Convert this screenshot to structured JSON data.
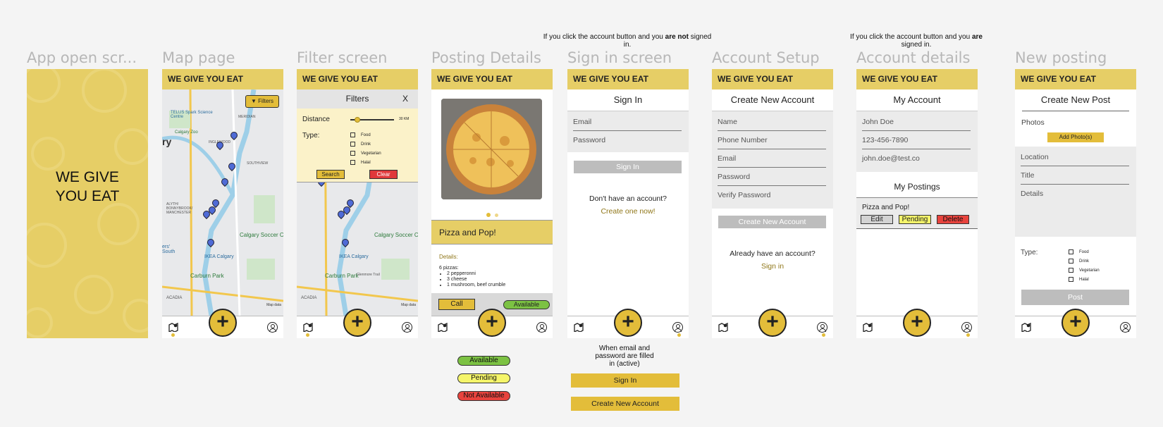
{
  "brand": "WE GIVE YOU EAT",
  "titles": [
    "App open scr...",
    "Map page",
    "Filter screen",
    "Posting Details",
    "Sign in screen",
    "Account Setup",
    "Account details",
    "New posting"
  ],
  "notes": {
    "not_signed_pre": "If you click the account button and you ",
    "not_signed_bold": "are not",
    "not_signed_post": " signed in.",
    "signed_pre": "If you click the account button and you ",
    "signed_bold": "are",
    "signed_post": " signed in.",
    "active_state": "When email and password are filled in (active)"
  },
  "splash": {
    "line1": "WE GIVE",
    "line2": "YOU EAT"
  },
  "map": {
    "filters_button": "Filters",
    "labels": [
      "TELUS Spark Science Centre",
      "MERIDIAN",
      "ry",
      "Calgary Zoo",
      "INGLEWOOD",
      "SOUTHVIEW",
      "FOREST HEIGHTS",
      "ALYTH/ BONNYBROOK/ MANCHESTER",
      "Calgary Soccer Cent",
      "IKEA Calgary",
      "ers' South",
      "Carburn Park",
      "Glenmore Trail",
      "ACADIA",
      "Map data",
      "Memorial Dr"
    ]
  },
  "filter": {
    "title": "Filters",
    "close": "X",
    "distance_label": "Distance",
    "distance_value": "30 KM",
    "type_label": "Type:",
    "types": [
      "Food",
      "Drink",
      "Vegetarian",
      "Halal"
    ],
    "search": "Search",
    "clear": "Clear"
  },
  "posting": {
    "title": "Pizza and Pop!",
    "details_label": "Details:",
    "summary": "6 pizzas:",
    "items": [
      "2 pepperonni",
      "3 cheese",
      "1 mushroom, beef crumble"
    ],
    "call": "Call",
    "status": "Available"
  },
  "status_legend": {
    "available": "Available",
    "pending": "Pending",
    "not_available": "Not Available"
  },
  "signin": {
    "title": "Sign In",
    "email": "Email",
    "password": "Password",
    "button": "Sign In",
    "no_account": "Don't have an account?",
    "create_link": "Create one now!",
    "active_signin": "Sign In",
    "active_create": "Create New Account"
  },
  "setup": {
    "title": "Create New Account",
    "fields": [
      "Name",
      "Phone Number",
      "Email",
      "Password",
      "Verify Password"
    ],
    "button": "Create New Account",
    "have_account": "Already have an account?",
    "signin_link": "Sign in"
  },
  "account": {
    "title": "My Account",
    "name": "John Doe",
    "phone": "123-456-7890",
    "email": "john.doe@test.co",
    "postings_title": "My Postings",
    "posting_name": "Pizza and Pop!",
    "edit": "Edit",
    "pending": "Pending",
    "delete": "Delete"
  },
  "newpost": {
    "title": "Create New Post",
    "photos": "Photos",
    "add_photos": "Add Photo(s)",
    "location": "Location",
    "post_title": "Title",
    "details": "Details",
    "type_label": "Type:",
    "types": [
      "Food",
      "Drink",
      "Vegetarian",
      "Halal"
    ],
    "post": "Post"
  },
  "colors": {
    "brand_yellow": "#e6ce66",
    "fab_yellow": "#e3bd3a",
    "available_green": "#7cc243",
    "pending_yellow": "#f5f56a",
    "not_available_red": "#e8433d",
    "clear_red": "#e0383b",
    "pin_blue": "#4f6bd6"
  },
  "icons": [
    "map-pin-icon",
    "plus-icon",
    "user-icon",
    "filter-icon",
    "pizza-photo"
  ]
}
